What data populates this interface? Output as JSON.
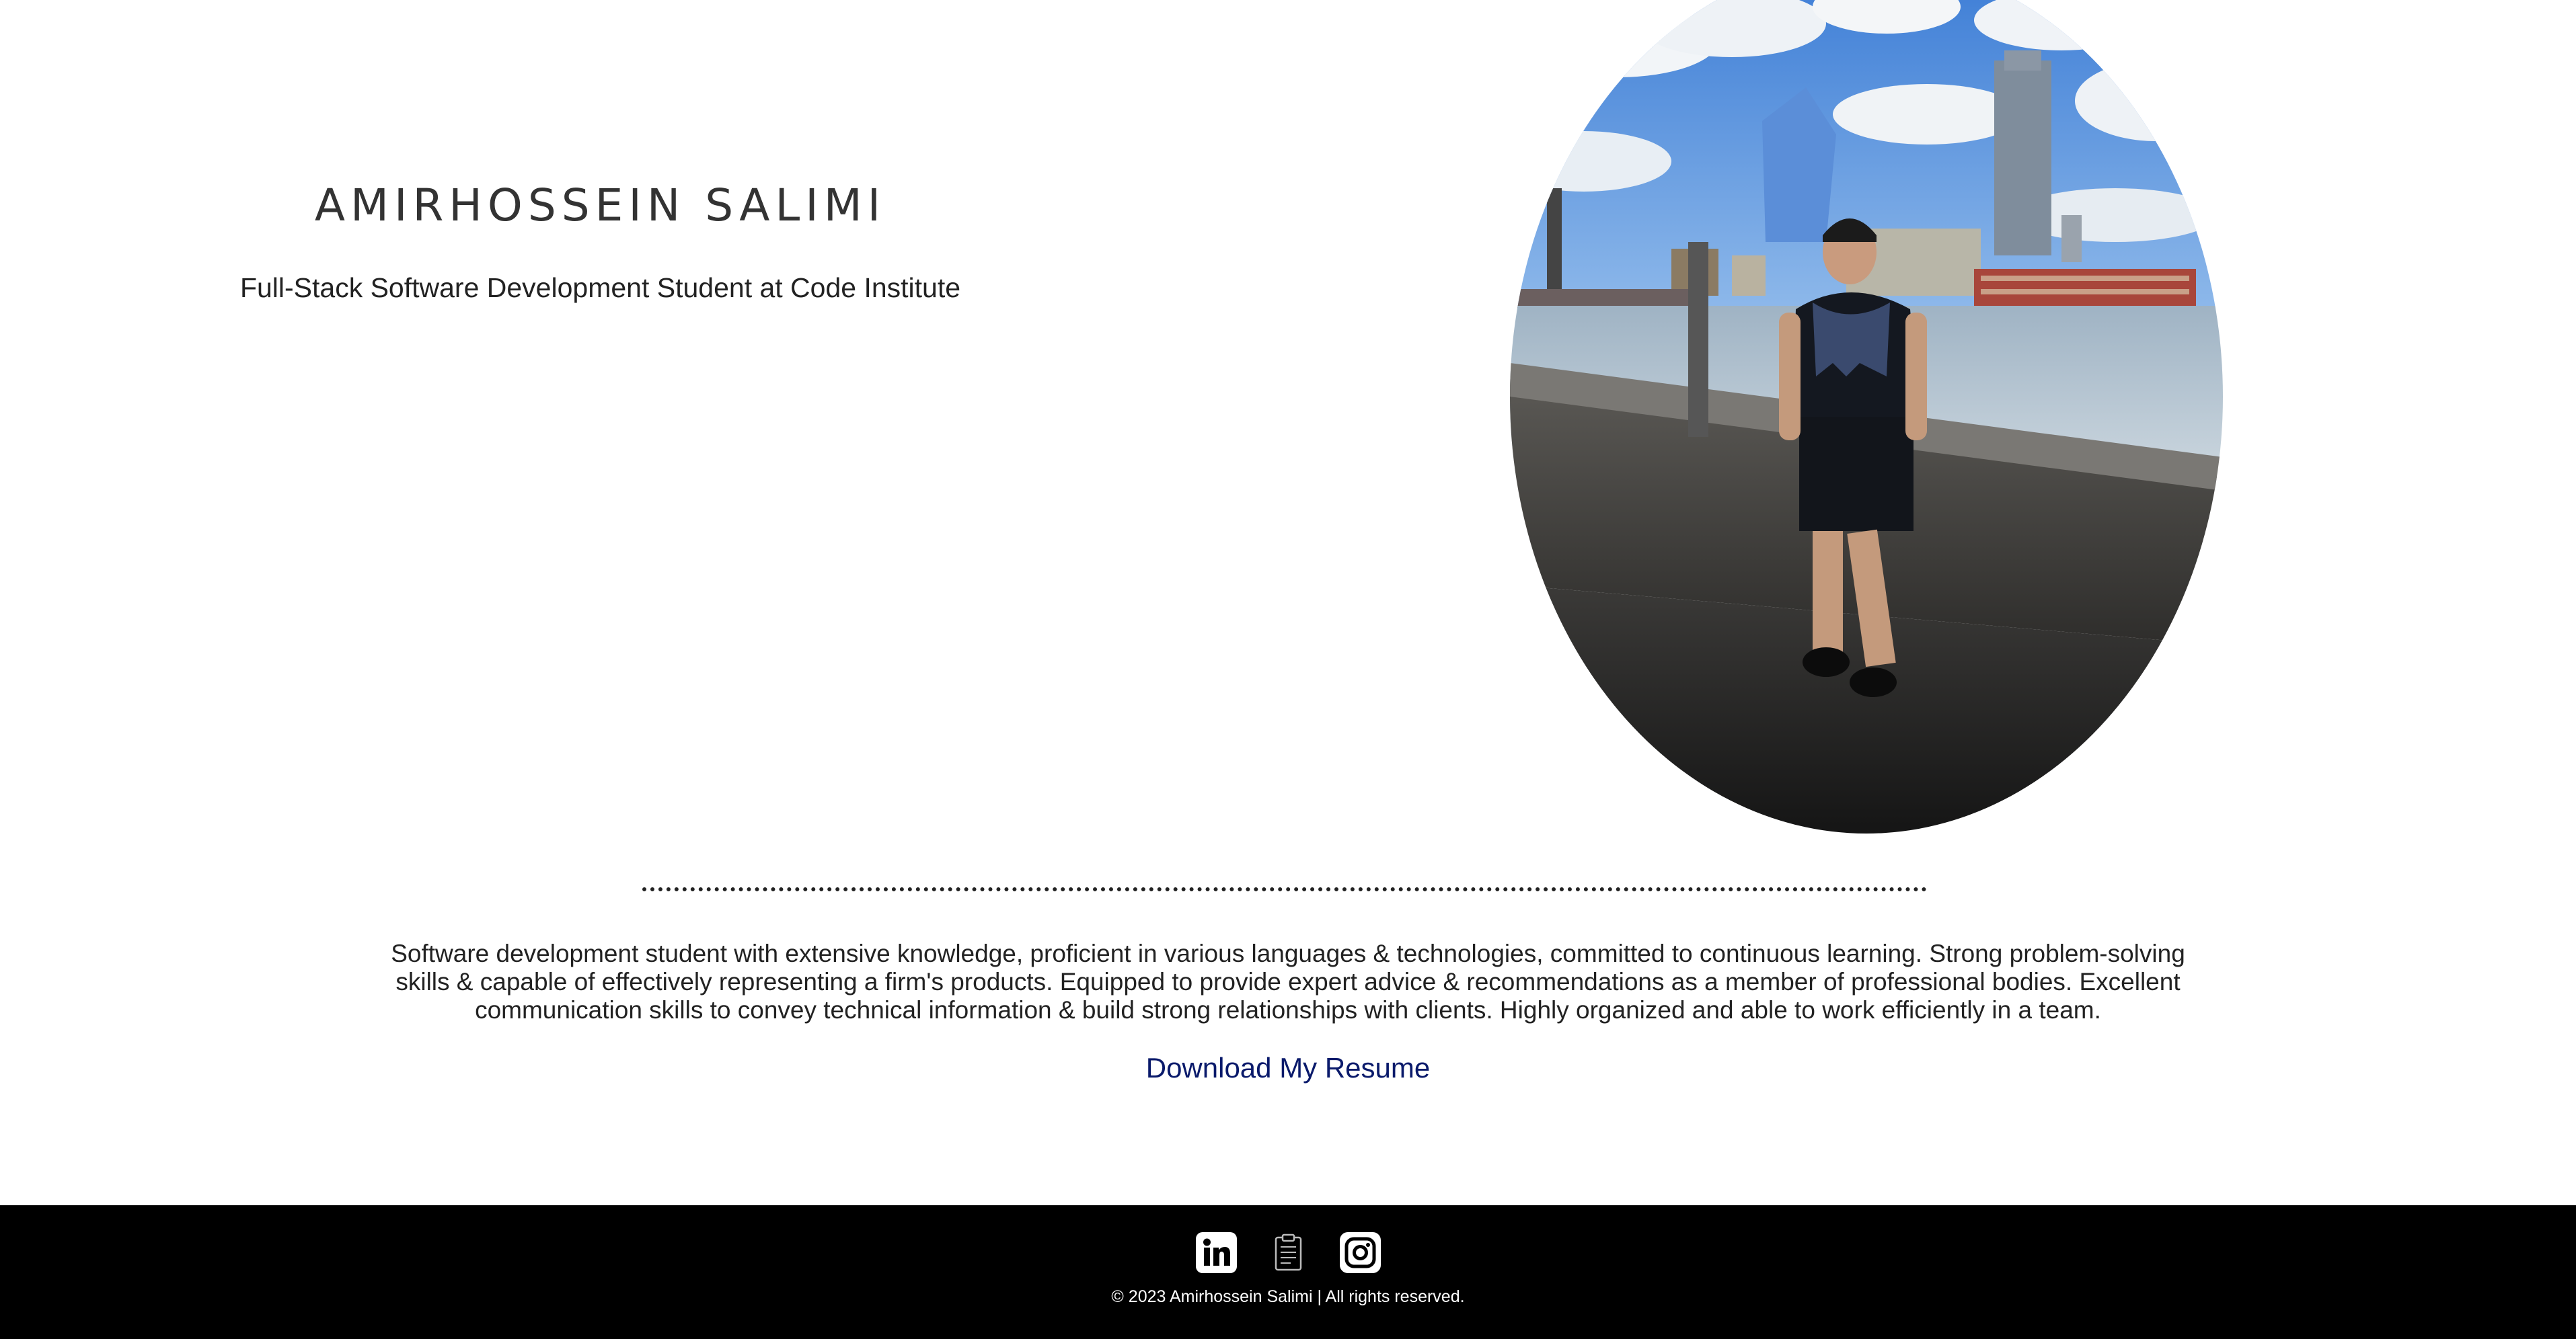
{
  "hero": {
    "name": "AMIRHOSSEIN SALIMI",
    "subtitle": "Full-Stack Software Development Student at Code Institute"
  },
  "photo": {
    "alt": "Amirhossein Salimi standing by the river Thames"
  },
  "about": {
    "text": "Software development student with extensive knowledge, proficient in various languages & technologies, committed to continuous learning. Strong problem-solving skills & capable of effectively representing a firm's products. Equipped to provide expert advice & recommendations as a member of professional bodies. Excellent communication skills to convey technical information & build strong relationships with clients. Highly organized and able to work efficiently in a team.",
    "resume_link": "Download My Resume"
  },
  "footer": {
    "social": [
      {
        "icon": "linkedin-icon"
      },
      {
        "icon": "resume-clipboard-icon"
      },
      {
        "icon": "instagram-icon"
      }
    ],
    "copyright": "© 2023 Amirhossein Salimi | All rights reserved."
  },
  "colors": {
    "link": "#0a1a6b",
    "footer_bg": "#000000",
    "text": "#222222"
  }
}
